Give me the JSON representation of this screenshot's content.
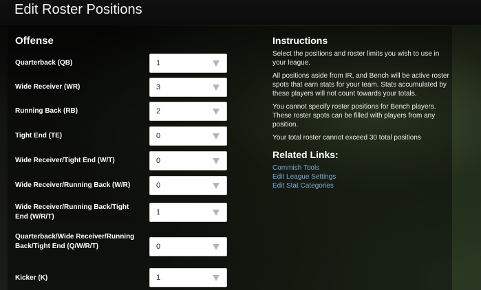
{
  "page": {
    "title": "Edit Roster Positions"
  },
  "offense": {
    "title": "Offense",
    "rows": [
      {
        "label": "Quarterback (QB)",
        "value": "1"
      },
      {
        "label": "Wide Receiver (WR)",
        "value": "3"
      },
      {
        "label": "Running Back (RB)",
        "value": "2"
      },
      {
        "label": "Tight End (TE)",
        "value": "0"
      },
      {
        "label": "Wide Receiver/Tight End (W/T)",
        "value": "0"
      },
      {
        "label": "Wide Receiver/Running Back (W/R)",
        "value": "0"
      },
      {
        "label": "Wide Receiver/Running Back/Tight End (W/R/T)",
        "value": "1"
      },
      {
        "label": "Quarterback/Wide Receiver/Running Back/Tight End (Q/W/R/T)",
        "value": "0"
      },
      {
        "label": "Kicker (K)",
        "value": "1"
      }
    ]
  },
  "instructions": {
    "title": "Instructions",
    "paragraphs": [
      "Select the positions and roster limits you wish to use in your league.",
      "All positions aside from IR, and Bench will be active roster spots that earn stats for your team. Stats accumulated by these players will not count towards your totals.",
      "You cannot specify roster positions for Bench players. These roster spots can be filled with players from any position.",
      "Your total roster cannot exceed 30 total positions"
    ]
  },
  "related_links": {
    "title": "Related Links:",
    "links": [
      "Commish Tools",
      "Edit League Settings",
      "Edit Stat Categories"
    ]
  },
  "icons": {
    "dropdown": "chevron-down-icon"
  }
}
